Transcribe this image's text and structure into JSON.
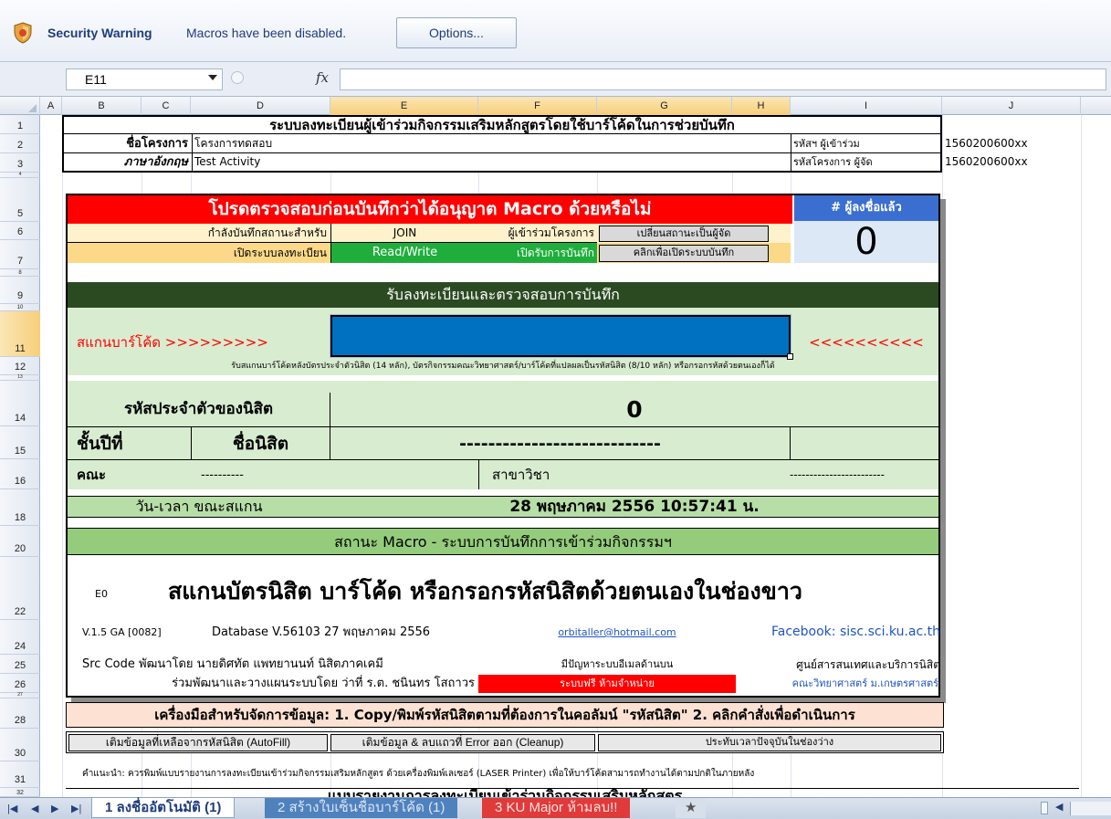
{
  "security_bar": {
    "title": "Security Warning",
    "message": "Macros have been disabled.",
    "options_label": "Options..."
  },
  "formula_bar": {
    "name_box": "E11",
    "fx": "fx",
    "formula": ""
  },
  "columns": [
    "A",
    "B",
    "C",
    "D",
    "E",
    "F",
    "G",
    "H",
    "I",
    "J"
  ],
  "rows": [
    "1",
    "2",
    "3",
    "4",
    "5",
    "6",
    "7",
    "8",
    "9",
    "10",
    "11",
    "12",
    "13",
    "14",
    "15",
    "16",
    "18",
    "20",
    "22",
    "24",
    "25",
    "26",
    "27",
    "28",
    "30",
    "31",
    "32"
  ],
  "sheet": {
    "main_title": "ระบบลงทะเบียนผู้เข้าร่วมกิจกรรมเสริมหลักสูตรโดยใช้บาร์โค้ดในการช่วยบันทึก",
    "project_name_label": "ชื่อโครงการ",
    "project_name_value": "โครงการทดสอบ",
    "english_label": "ภาษาอังกฤษ",
    "english_value": "Test Activity",
    "participant_code_label": "รหัสฯ ผู้เข้าร่วม",
    "participant_code_value": "1560200600xx",
    "organizer_code_label": "รหัสโครงการ ผู้จัด",
    "organizer_code_value": "1560200600xx",
    "macro_warning": "โปรดตรวจสอบก่อนบันทึกว่าได้อนุญาต Macro ด้วยหรือไม่",
    "registered_label": "# ผู้ลงชื่อแล้ว",
    "registered_count": "0",
    "recording_status_label": "กำลังบันทึกสถานะสำหรับ",
    "join_value": "JOIN",
    "participant_role": "ผู้เข้าร่วมโครงการ",
    "switch_organizer_button": "เปลี่ยนสถานะเป็นผู้จัด",
    "open_registration_label": "เปิดระบบลงทะเบียน",
    "read_write_value": "Read/Write",
    "recording_open": "เปิดรับการบันทึก",
    "open_recording_button": "คลิกเพื่อเปิดระบบบันทึก",
    "register_header": "รับลงทะเบียนและตรวจสอบการบันทึก",
    "scan_label": "สแกนบาร์โค้ด >>>>>>>>>",
    "scan_arrows_right": "<<<<<<<<<<",
    "scan_hint": "รับสแกนบาร์โค้ดหลังบัตรประจำตัวนิสิต (14 หลัก), บัตรกิจกรรมคณะวิทยาศาสตร์/บาร์โค้ดที่แปลผลเป็นรหัสนิสิต (8/10 หลัก) หรือกรอกรหัสด้วยตนเองก็ได้",
    "student_id_label": "รหัสประจำตัวของนิสิต",
    "student_id_value": "0",
    "year_label": "ชั้นปีที่",
    "student_name_label": "ชื่อนิสิต",
    "student_name_value": "----------------------------",
    "faculty_label": "คณะ",
    "faculty_value": "----------",
    "major_label": "สาขาวิชา",
    "major_value": "------------------------",
    "scan_time_label": "วัน-เวลา ขณะสแกน",
    "scan_time_value": "28 พฤษภาคม 2556 10:57:41 น.",
    "macro_status_header": "สถานะ Macro - ระบบการบันทึกการเข้าร่วมกิจกรรมฯ",
    "status_code": "E0",
    "status_message": "สแกนบัตรนิสิต บาร์โค้ด หรือกรอกรหัสนิสิตด้วยตนเองในช่องขาว",
    "version": "V.1.5 GA [0082]",
    "database": "Database V.56103 27 พฤษภาคม 2556",
    "email": "orbitaller@hotmail.com",
    "facebook": "Facebook: sisc.sci.ku.ac.th",
    "src_code": "Src Code พัฒนาโดย นายดิศทัต  แพทยานนท์ นิสิตภาคเคมี",
    "problem_hint": "มีปัญหาระบบอีเมลด้านบน",
    "center": "ศูนย์สารสนเทศและบริการนิสิต",
    "co_dev": "ร่วมพัฒนาและวางแผนระบบโดย ว่าที่ ร.ต. ชนินทร โสถาวร",
    "free_system": "ระบบฟรี ห้ามจำหน่าย",
    "faculty_link": "คณะวิทยาศาสตร์ ม.เกษตรศาสตร์",
    "tools_header": "เครื่องมือสำหรับจัดการข้อมูล: 1. Copy/พิมพ์รหัสนิสิตตามที่ต้องการในคอลัมน์ \"รหัสนิสิต\" 2. คลิกคำสั่งเพื่อดำเนินการ",
    "autofill_button": "เติมข้อมูลที่เหลือจากรหัสนิสิต (AutoFill)",
    "cleanup_button": "เติมข้อมูล & ลบแถวที่ Error ออก (Cleanup)",
    "timestamp_button": "ประทับเวลาปัจจุบันในช่องว่าง",
    "advice": "คำแนะนำ: ควรพิมพ์แบบรายงานการลงทะเบียนเข้าร่วมกิจกรรมเสริมหลักสูตร ด้วยเครื่องพิมพ์เลเซอร์ (LASER Printer) เพื่อให้บาร์โค้ดสามารถทำงานได้ตามปกติในภายหลัง",
    "report_header": "แบบรายงานการลงทะเบียนเข้าร่วมกิจกรรมเสริมหลักสูตร"
  },
  "tabs": [
    {
      "label": "1 ลงชื่ออัตโนมัติ (1)",
      "color": "#ffffff"
    },
    {
      "label": "2 สร้างใบเซ็นชื่อบาร์โค้ด (1)",
      "color": "#4f81bd"
    },
    {
      "label": "3 KU Major ห้ามลบ!!",
      "color": "#e03a3a"
    }
  ],
  "colors": {
    "red": "#ff0000",
    "dark_green": "#2b4a22",
    "light_green": "#d8ecd0",
    "mid_green": "#b7dea7",
    "blue_header": "#3a6fd1",
    "scan_blue": "#0070c0",
    "button_green": "#1fae3c"
  }
}
